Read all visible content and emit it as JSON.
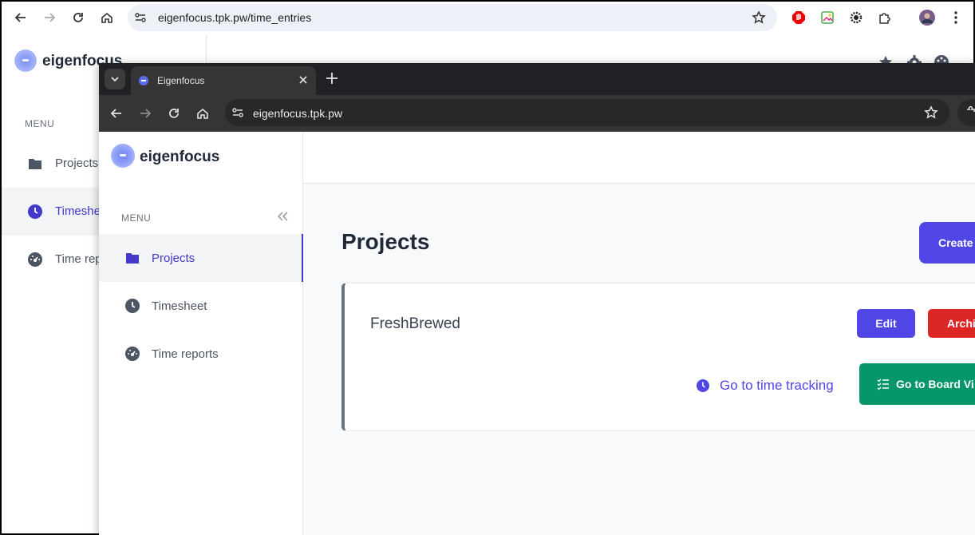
{
  "back_browser": {
    "url": "eigenfocus.tpk.pw/time_entries",
    "brand": "eigenfocus",
    "menu_label": "MENU",
    "menu_items": [
      {
        "label": "Projects",
        "icon": "folder-icon"
      },
      {
        "label": "Timesheet",
        "icon": "clock-icon"
      },
      {
        "label": "Time reports",
        "icon": "dashboard-icon"
      }
    ]
  },
  "front_browser": {
    "tab_title": "Eigenfocus",
    "url": "eigenfocus.tpk.pw"
  },
  "app": {
    "brand": "eigenfocus",
    "menu_label": "MENU",
    "menu_items": [
      {
        "label": "Projects",
        "icon": "folder-icon",
        "active": true
      },
      {
        "label": "Timesheet",
        "icon": "clock-icon"
      },
      {
        "label": "Time reports",
        "icon": "dashboard-icon"
      }
    ],
    "page_title": "Projects",
    "create_button": "Create",
    "projects": [
      {
        "name": "FreshBrewed",
        "edit_label": "Edit",
        "archive_label": "Archi",
        "time_tracking_label": "Go to time tracking",
        "board_view_label": "Go to Board Vi"
      }
    ]
  },
  "colors": {
    "accent": "#4f46e5",
    "danger": "#dc2626",
    "success": "#059669"
  }
}
